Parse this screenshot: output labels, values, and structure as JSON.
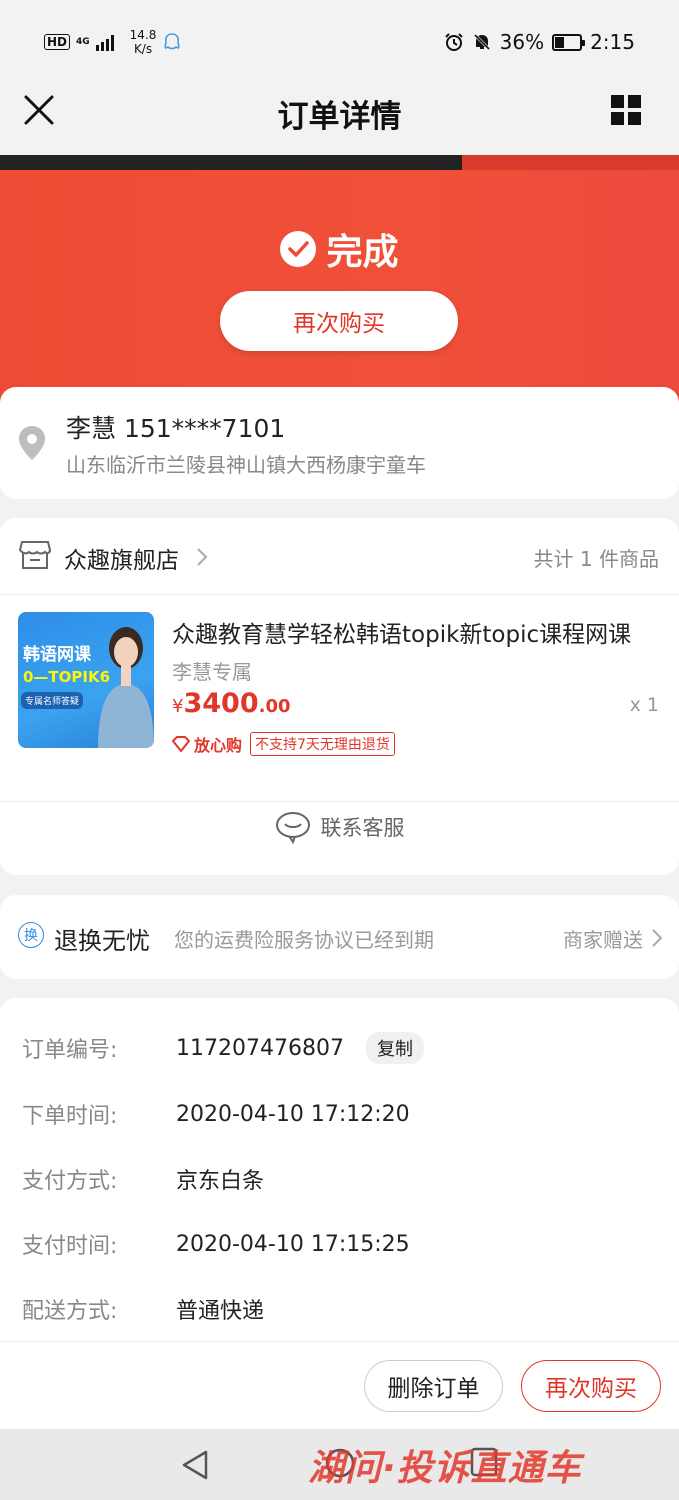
{
  "status_bar": {
    "hd": "HD",
    "network": "4G",
    "speed_value": "14.8",
    "speed_unit": "K/s",
    "battery": "36%",
    "time": "2:15"
  },
  "navbar": {
    "title": "订单详情",
    "close_icon": "close-icon",
    "menu_icon": "grid-icon"
  },
  "order_status": {
    "text": "完成",
    "rebuy_label": "再次购买"
  },
  "address": {
    "name_phone": "李慧 151****7101",
    "detail": "山东临沂市兰陵县神山镇大西杨康宇童车"
  },
  "shop": {
    "name": "众趣旗舰店",
    "count_text": "共计 1 件商品",
    "product": {
      "title": "众趣教育慧学轻松韩语topik新topic课程网课",
      "spec": "李慧专属",
      "price_currency": "¥",
      "price_int": "3400",
      "price_dec": ".00",
      "quantity": "x 1",
      "badge_safe": "放心购",
      "badge_no_return": "不支持7天无理由退货",
      "thumb_title": "韩语网课",
      "thumb_sub": "0—TOPIK6",
      "thumb_tag": "专属名师答疑"
    },
    "service_label": "联系客服"
  },
  "refund": {
    "icon_text": "换",
    "title": "退换无忧",
    "desc": "您的运费险服务协议已经到期",
    "gift": "商家赠送"
  },
  "info": {
    "rows": [
      {
        "label": "订单编号:",
        "value": "117207476807"
      },
      {
        "label": "下单时间:",
        "value": "2020-04-10 17:12:20"
      },
      {
        "label": "支付方式:",
        "value": "京东白条"
      },
      {
        "label": "支付时间:",
        "value": "2020-04-10 17:15:25"
      },
      {
        "label": "配送方式:",
        "value": "普通快递"
      }
    ],
    "copy_label": "复制"
  },
  "footer": {
    "delete_label": "删除订单",
    "rebuy_label": "再次购买"
  },
  "watermark": "湖问·投诉直通车",
  "colors": {
    "accent": "#e2362a",
    "hero": "#ef4b34"
  }
}
